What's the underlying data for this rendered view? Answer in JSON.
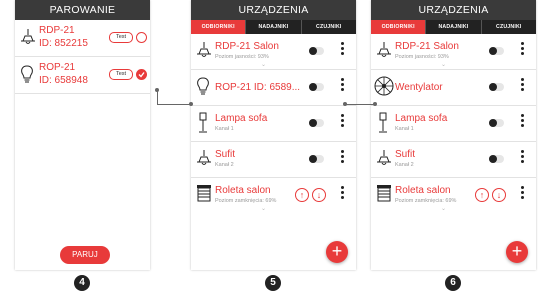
{
  "screen1": {
    "title": "PAROWANIE",
    "devices": [
      {
        "name": "RDP-21",
        "id": "ID: 852215",
        "test_label": "Test",
        "selected": false,
        "icon": "ceiling-lamp-icon"
      },
      {
        "name": "ROP-21",
        "id": "ID: 658948",
        "test_label": "Test",
        "selected": true,
        "icon": "bulb-icon"
      }
    ],
    "pair_button": "PARUJ",
    "step": "4"
  },
  "screen2": {
    "title": "URZĄDZENIA",
    "tabs": [
      "ODBIORNIKI",
      "NADAJNIKI",
      "CZUJNIKI"
    ],
    "rows": [
      {
        "name": "RDP-21 Salon",
        "sub": "Poziom jasności: 93%",
        "icon": "ceiling-lamp-icon"
      },
      {
        "name": "ROP-21 ID: 6589...",
        "sub": "",
        "icon": "bulb-icon"
      },
      {
        "name": "Lampa sofa",
        "sub": "Kanał 1",
        "icon": "floor-lamp-icon"
      },
      {
        "name": "Sufit",
        "sub": "Kanał 2",
        "icon": "ceiling-lamp-icon"
      },
      {
        "name": "Roleta salon",
        "sub": "Poziom zamknięcia: 69%",
        "icon": "roller-blind-icon"
      }
    ],
    "step": "5"
  },
  "screen3": {
    "title": "URZĄDZENIA",
    "tabs": [
      "ODBIORNIKI",
      "NADAJNIKI",
      "CZUJNIKI"
    ],
    "rows": [
      {
        "name": "RDP-21 Salon",
        "sub": "Poziom jasności: 93%",
        "icon": "ceiling-lamp-icon"
      },
      {
        "name": "Wentylator",
        "sub": "",
        "icon": "fan-icon"
      },
      {
        "name": "Lampa sofa",
        "sub": "Kanał 1",
        "icon": "floor-lamp-icon"
      },
      {
        "name": "Sufit",
        "sub": "Kanał 2",
        "icon": "ceiling-lamp-icon"
      },
      {
        "name": "Roleta salon",
        "sub": "Poziom zamknięcia: 69%",
        "icon": "roller-blind-icon"
      }
    ],
    "step": "6"
  },
  "colors": {
    "accent": "#e83a3a",
    "header": "#3a3a3a"
  }
}
